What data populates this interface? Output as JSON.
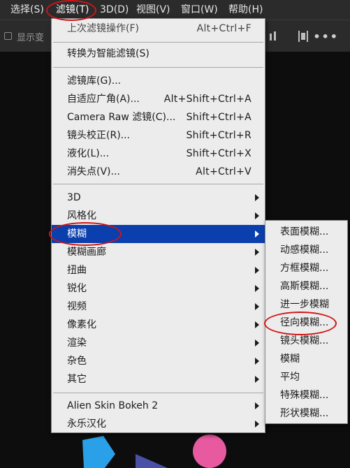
{
  "menubar": {
    "items": [
      {
        "label": "选择(S)"
      },
      {
        "label": "滤镜(T)"
      },
      {
        "label": "3D(D)"
      },
      {
        "label": "视图(V)"
      },
      {
        "label": "窗口(W)"
      },
      {
        "label": "帮助(H)"
      }
    ]
  },
  "options_bar": {
    "checkbox_label": "显示变"
  },
  "filter_menu": {
    "items": [
      {
        "label": "上次滤镜操作(F)",
        "shortcut": "Alt+Ctrl+F"
      },
      {
        "label": "转换为智能滤镜(S)"
      },
      {
        "label": "滤镜库(G)..."
      },
      {
        "label": "自适应广角(A)...",
        "shortcut": "Alt+Shift+Ctrl+A"
      },
      {
        "label": "Camera Raw 滤镜(C)...",
        "shortcut": "Shift+Ctrl+A"
      },
      {
        "label": "镜头校正(R)...",
        "shortcut": "Shift+Ctrl+R"
      },
      {
        "label": "液化(L)...",
        "shortcut": "Shift+Ctrl+X"
      },
      {
        "label": "消失点(V)...",
        "shortcut": "Alt+Ctrl+V"
      },
      {
        "label": "3D"
      },
      {
        "label": "风格化"
      },
      {
        "label": "模糊"
      },
      {
        "label": "模糊画廊"
      },
      {
        "label": "扭曲"
      },
      {
        "label": "锐化"
      },
      {
        "label": "视频"
      },
      {
        "label": "像素化"
      },
      {
        "label": "渲染"
      },
      {
        "label": "杂色"
      },
      {
        "label": "其它"
      },
      {
        "label": "Alien Skin Bokeh 2"
      },
      {
        "label": "永乐汉化"
      }
    ]
  },
  "blur_submenu": {
    "items": [
      {
        "label": "表面模糊..."
      },
      {
        "label": "动感模糊..."
      },
      {
        "label": "方框模糊..."
      },
      {
        "label": "高斯模糊..."
      },
      {
        "label": "进一步模糊"
      },
      {
        "label": "径向模糊..."
      },
      {
        "label": "镜头模糊..."
      },
      {
        "label": "模糊"
      },
      {
        "label": "平均"
      },
      {
        "label": "特殊模糊..."
      },
      {
        "label": "形状模糊..."
      }
    ]
  },
  "colors": {
    "highlight": "#0a3fad",
    "annotation_circle": "#d01515",
    "menu_bg": "#ececec",
    "app_bg": "#2b2b2b"
  }
}
